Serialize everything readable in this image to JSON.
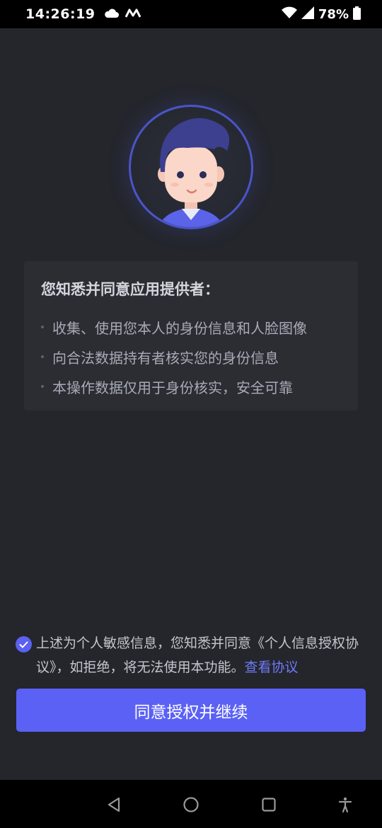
{
  "status_bar": {
    "time": "14:26:19",
    "battery": "78%",
    "icons": [
      "cloud-icon",
      "m-logo-icon",
      "wifi-icon",
      "signal-icon",
      "battery-icon"
    ]
  },
  "avatar": {
    "icon": "user-avatar-icon"
  },
  "info": {
    "title": "您知悉并同意应用提供者：",
    "items": [
      "收集、使用您本人的身份信息和人脸图像",
      "向合法数据持有者核实您的身份信息",
      "本操作数据仅用于身份核实，安全可靠"
    ]
  },
  "consent": {
    "checked": true,
    "text": "上述为个人敏感信息，您知悉并同意《个人信息授权协议》，如拒绝，将无法使用本功能。",
    "link": "查看协议"
  },
  "primary_button": {
    "label": "同意授权并继续"
  },
  "nav_bar": {
    "icons": [
      "back-icon",
      "home-icon",
      "recents-icon",
      "accessibility-icon"
    ]
  },
  "colors": {
    "accent": "#5b61f5",
    "link": "#6f7bf7",
    "background": "#24262c"
  }
}
